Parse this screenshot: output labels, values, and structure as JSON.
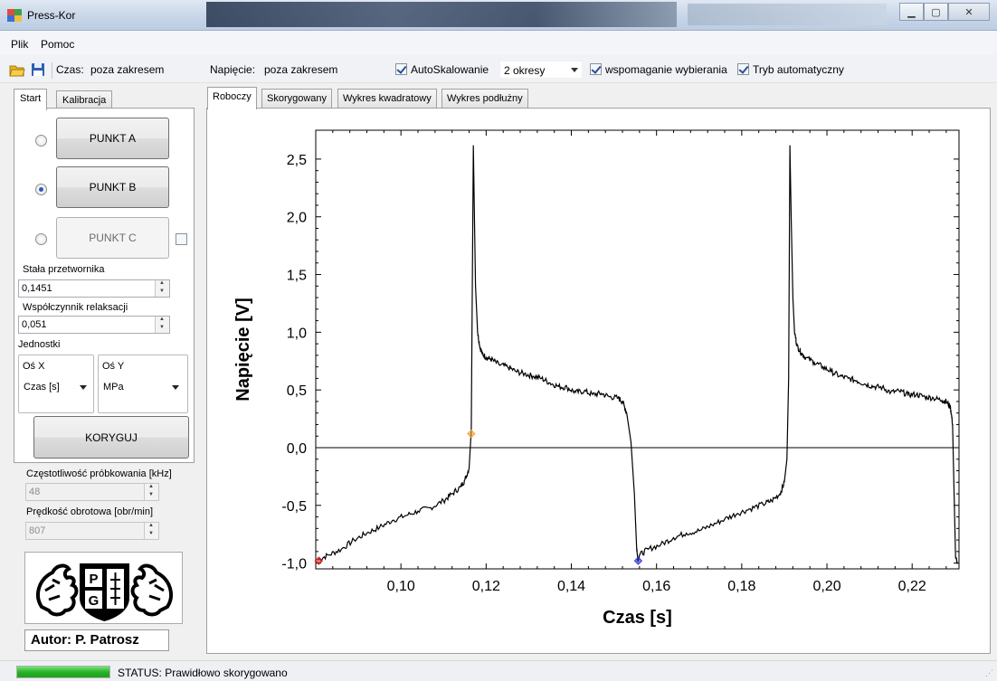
{
  "window": {
    "title": "Press-Kor"
  },
  "menu": {
    "items": [
      "Plik",
      "Pomoc"
    ]
  },
  "toolbar": {
    "czas_label": "Czas:",
    "czas_value": "poza zakresem",
    "napiecie_label": "Napięcie:",
    "napiecie_value": "poza zakresem",
    "autoscale_label": "AutoSkalowanie",
    "periods_value": "2 okresy",
    "assist_label": "wspomaganie wybierania",
    "auto_mode_label": "Tryb automatyczny"
  },
  "left_tabs": [
    "Start",
    "Kalibracja"
  ],
  "left": {
    "point_a": "PUNKT A",
    "point_b": "PUNKT B",
    "point_c": "PUNKT C",
    "transducer_label": "Stała przetwornika",
    "transducer_value": "0,1451",
    "relax_label": "Współczynnik relaksacji",
    "relax_value": "0,051",
    "units_label": "Jednostki",
    "axis_x_label": "Oś X",
    "axis_x_value": "Czas [s]",
    "axis_y_label": "Oś Y",
    "axis_y_value": "MPa",
    "correct_button": "KORYGUJ",
    "sampling_label": "Częstotliwość próbkowania [kHz]",
    "sampling_value": "48",
    "speed_label": "Prędkość obrotowa [obr/min]",
    "speed_value": "807",
    "author": "Autor: P. Patrosz"
  },
  "right_tabs": [
    "Roboczy",
    "Skorygowany",
    "Wykres kwadratowy",
    "Wykres podłużny"
  ],
  "status": {
    "label": "STATUS:",
    "text": "Prawidłowo skorygowano",
    "progress": 1.0
  },
  "colors": {
    "marker_a": "#d01818",
    "marker_b": "#f0a030",
    "marker_c": "#2f3bd6"
  },
  "chart_data": {
    "type": "line",
    "xlabel": "Czas [s]",
    "ylabel": "Napięcie [V]",
    "xlim": [
      0.08,
      0.231
    ],
    "ylim": [
      -1.05,
      2.75
    ],
    "xticks": [
      0.1,
      0.12,
      0.14,
      0.16,
      0.18,
      0.2,
      0.22
    ],
    "xtick_labels": [
      "0,10",
      "0,12",
      "0,14",
      "0,16",
      "0,18",
      "0,20",
      "0,22"
    ],
    "yticks": [
      -1.0,
      -0.5,
      0.0,
      0.5,
      1.0,
      1.5,
      2.0,
      2.5
    ],
    "ytick_labels": [
      "-1,0",
      "-0,5",
      "0,0",
      "0,5",
      "1,0",
      "1,5",
      "2,0",
      "2,5"
    ],
    "series": [
      {
        "x": [
          0.0805,
          0.083,
          0.086,
          0.089,
          0.092,
          0.095,
          0.098,
          0.101,
          0.104,
          0.107,
          0.11,
          0.112,
          0.114,
          0.115,
          0.116,
          0.1165,
          0.117,
          0.1172,
          0.1175,
          0.118,
          0.1185,
          0.119,
          0.12,
          0.121,
          0.123,
          0.125,
          0.127,
          0.129,
          0.131,
          0.133,
          0.135,
          0.137,
          0.139,
          0.141,
          0.143,
          0.145,
          0.147,
          0.149,
          0.151,
          0.152,
          0.153,
          0.154,
          0.1548,
          0.1553,
          0.1556,
          0.156,
          0.158,
          0.161,
          0.164,
          0.167,
          0.17,
          0.173,
          0.176,
          0.179,
          0.182,
          0.185,
          0.187,
          0.189,
          0.19,
          0.1906,
          0.191,
          0.1913,
          0.1916,
          0.192,
          0.1924,
          0.193,
          0.194,
          0.195,
          0.197,
          0.199,
          0.201,
          0.203,
          0.205,
          0.207,
          0.209,
          0.211,
          0.213,
          0.215,
          0.217,
          0.219,
          0.221,
          0.223,
          0.225,
          0.227,
          0.228,
          0.229,
          0.2295,
          0.2298,
          0.2302,
          0.2306
        ],
        "y": [
          -0.97,
          -0.93,
          -0.88,
          -0.8,
          -0.74,
          -0.69,
          -0.63,
          -0.59,
          -0.55,
          -0.52,
          -0.46,
          -0.4,
          -0.34,
          -0.28,
          -0.18,
          0.15,
          2.62,
          2.1,
          1.4,
          1.0,
          0.88,
          0.82,
          0.78,
          0.77,
          0.72,
          0.7,
          0.66,
          0.64,
          0.62,
          0.6,
          0.56,
          0.53,
          0.52,
          0.48,
          0.49,
          0.46,
          0.47,
          0.44,
          0.43,
          0.4,
          0.3,
          0.05,
          -0.4,
          -0.85,
          -0.97,
          -0.93,
          -0.88,
          -0.84,
          -0.78,
          -0.74,
          -0.72,
          -0.67,
          -0.62,
          -0.57,
          -0.53,
          -0.49,
          -0.46,
          -0.4,
          -0.3,
          -0.1,
          0.6,
          2.62,
          2.0,
          1.3,
          1.0,
          0.88,
          0.82,
          0.78,
          0.74,
          0.7,
          0.66,
          0.62,
          0.6,
          0.58,
          0.55,
          0.53,
          0.52,
          0.48,
          0.49,
          0.46,
          0.46,
          0.44,
          0.43,
          0.41,
          0.4,
          0.35,
          0.2,
          -0.3,
          -0.95,
          -1.0
        ]
      }
    ],
    "markers": [
      {
        "x": 0.0807,
        "y": -0.98,
        "color": "#d01818"
      },
      {
        "x": 0.1165,
        "y": 0.12,
        "color": "#f0a030"
      },
      {
        "x": 0.1557,
        "y": -0.98,
        "color": "#2f3bd6"
      }
    ]
  }
}
